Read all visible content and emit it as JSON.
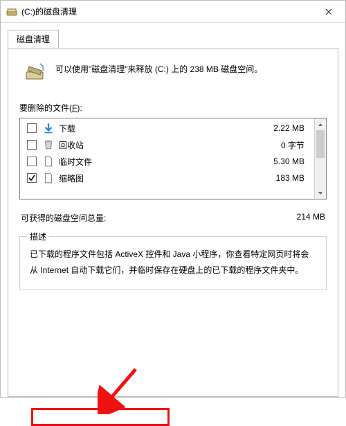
{
  "window": {
    "title": "(C:)的磁盘清理",
    "close_tooltip": "关闭"
  },
  "tab": {
    "label": "磁盘清理"
  },
  "intro": {
    "text": "可以使用\"磁盘清理\"来释放  (C:) 上的 238 MB 磁盘空间。"
  },
  "files": {
    "label_prefix": "要删除的文件(",
    "label_hotkey": "F",
    "label_suffix": "):",
    "items": [
      {
        "name": "下载",
        "size": "2.22 MB",
        "checked": false,
        "icon": "download"
      },
      {
        "name": "回收站",
        "size": "0 字节",
        "checked": false,
        "icon": "recycle"
      },
      {
        "name": "临时文件",
        "size": "5.30 MB",
        "checked": false,
        "icon": "file"
      },
      {
        "name": "缩略图",
        "size": "183 MB",
        "checked": true,
        "icon": "file"
      }
    ]
  },
  "total": {
    "label": "可获得的磁盘空间总量:",
    "value": "214 MB"
  },
  "description": {
    "legend": "描述",
    "text": "已下载的程序文件包括 ActiveX 控件和 Java 小程序，你查看特定网页时将会从 Internet 自动下载它们，并临时保存在硬盘上的已下载的程序文件夹中。"
  }
}
